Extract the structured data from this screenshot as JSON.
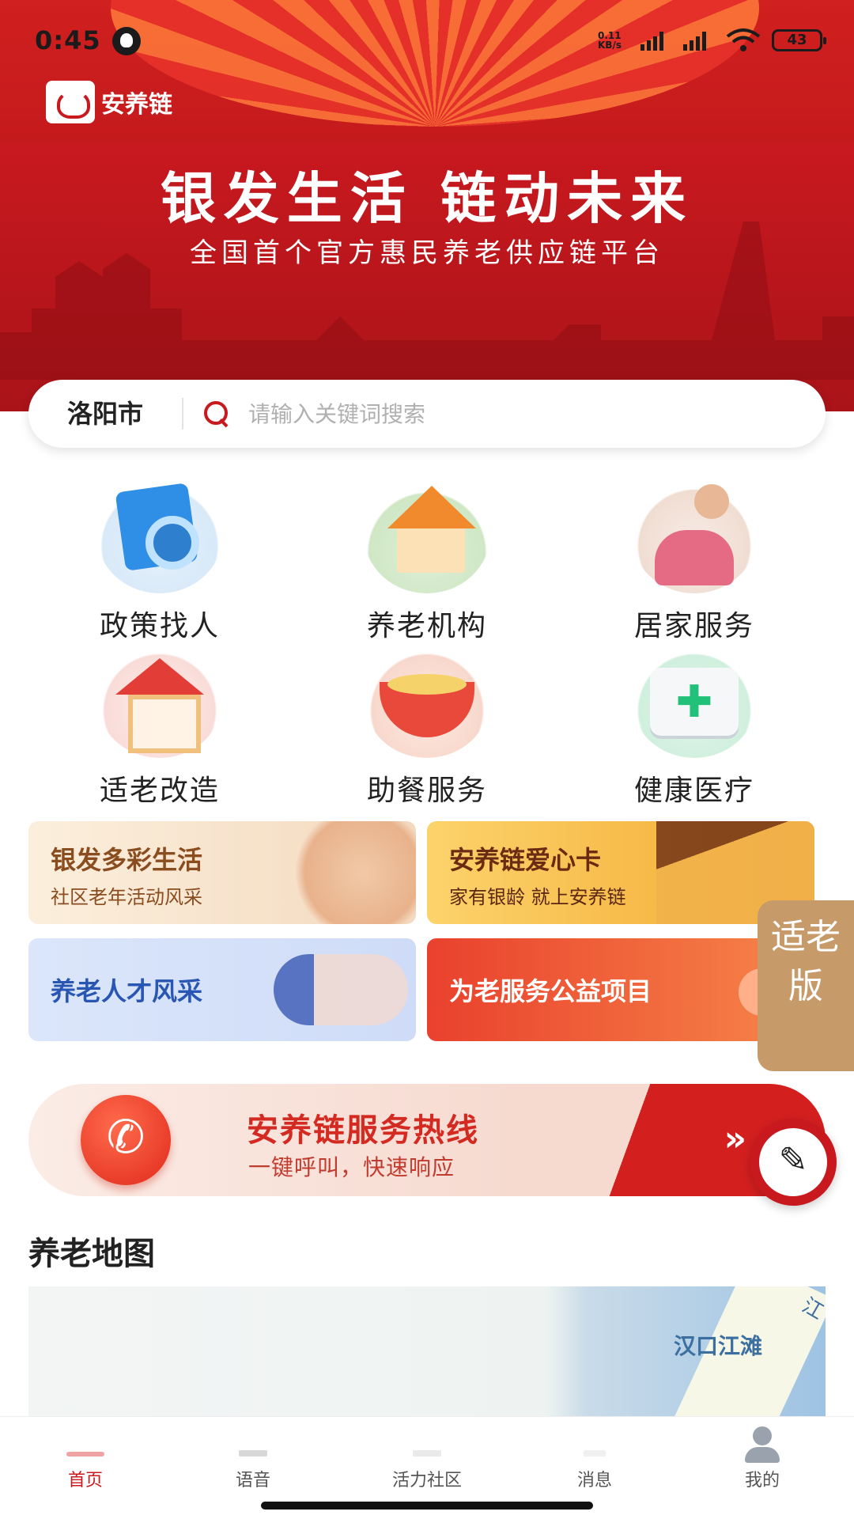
{
  "status_bar": {
    "time": "0:45",
    "speed": "0.11 KB/s",
    "battery": "43"
  },
  "app": {
    "logo_text": "安养链"
  },
  "hero": {
    "title": "银发生活  链动未来",
    "subtitle": "全国首个官方惠民养老供应链平台"
  },
  "search": {
    "city": "洛阳市",
    "placeholder": "请输入关键词搜索"
  },
  "services": [
    {
      "label": "政策找人",
      "icon": "policy-search-icon"
    },
    {
      "label": "养老机构",
      "icon": "nursing-home-icon"
    },
    {
      "label": "居家服务",
      "icon": "home-care-icon"
    },
    {
      "label": "适老改造",
      "icon": "home-renovation-icon"
    },
    {
      "label": "助餐服务",
      "icon": "meal-service-icon"
    },
    {
      "label": "健康医疗",
      "icon": "medical-kit-icon"
    }
  ],
  "banners": [
    {
      "title": "银发多彩生活",
      "subtitle": "社区老年活动风采"
    },
    {
      "title": "安养链爱心卡",
      "subtitle": "家有银龄 就上安养链"
    },
    {
      "title": "养老人才风采"
    },
    {
      "title": "为老服务公益项目"
    }
  ],
  "elder_mode": {
    "label": "适老版"
  },
  "hotline": {
    "title": "安养链服务热线",
    "subtitle": "一键呼叫，快速响应"
  },
  "map_section": {
    "title": "养老地图",
    "label": "汉口江滩",
    "label2": "江"
  },
  "tabs": [
    {
      "label": "首页",
      "active": true,
      "icon": "home-icon"
    },
    {
      "label": "语音",
      "icon": "voice-icon"
    },
    {
      "label": "活力社区",
      "icon": "community-icon"
    },
    {
      "label": "消息",
      "icon": "message-icon"
    },
    {
      "label": "我的",
      "icon": "profile-icon"
    }
  ],
  "colors": {
    "brand_red": "#c8191f",
    "elder_mode_bg": "#c79a6a"
  }
}
